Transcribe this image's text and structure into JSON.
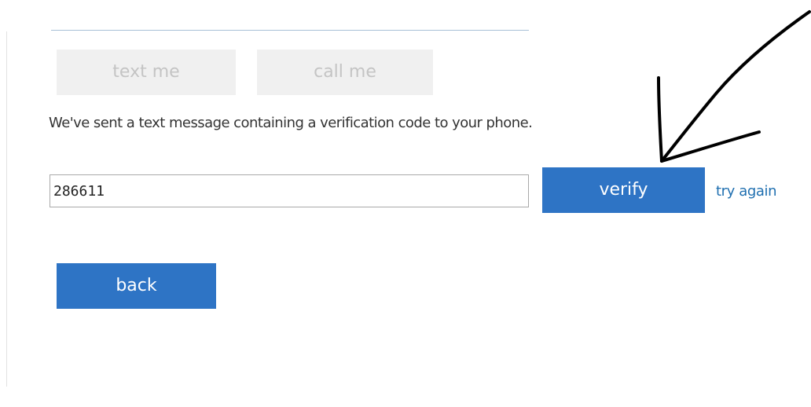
{
  "buttons": {
    "text_me_label": "text me",
    "call_me_label": "call me",
    "verify_label": "verify",
    "back_label": "back"
  },
  "message": "We've sent a text message containing a verification code to your phone.",
  "code_input": {
    "value": "286611"
  },
  "links": {
    "try_again_label": "try again"
  },
  "colors": {
    "primary": "#2e74c5",
    "link": "#1f6fb0",
    "disabled_bg": "#f0f0f0",
    "disabled_text": "#c4c4c4",
    "annotation": "#000000"
  }
}
